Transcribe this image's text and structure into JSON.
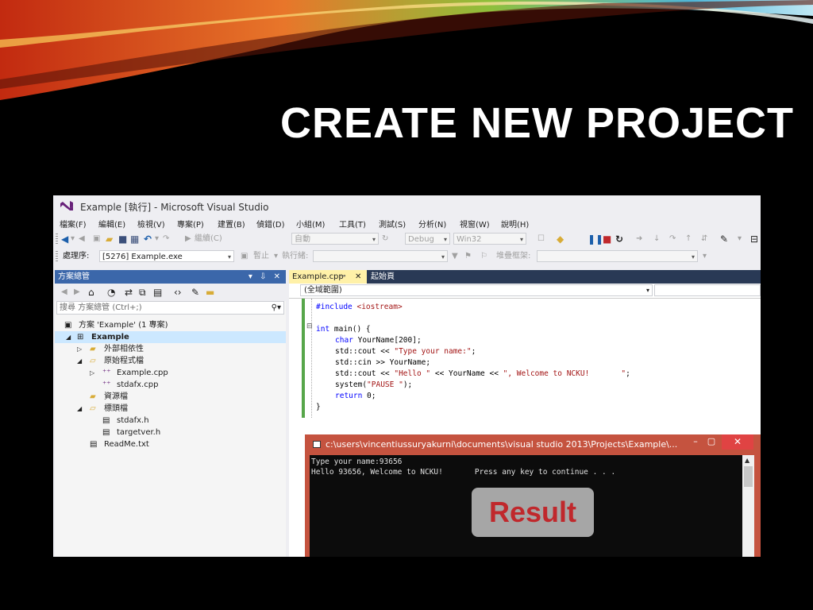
{
  "slide": {
    "title": "CREATE NEW PROJECT",
    "result_label": "Result"
  },
  "window": {
    "title": "Example [執行] - Microsoft Visual Studio"
  },
  "menu": [
    "檔案(F)",
    "編輯(E)",
    "檢視(V)",
    "專案(P)",
    "建置(B)",
    "偵錯(D)",
    "小組(M)",
    "工具(T)",
    "測試(S)",
    "分析(N)",
    "視窗(W)",
    "說明(H)"
  ],
  "toolbar1": {
    "continue_label": "繼續(C)",
    "auto_combo": "自動",
    "config_combo": "Debug",
    "platform_combo": "Win32"
  },
  "toolbar2": {
    "process_label": "處理序:",
    "process_value": "[5276] Example.exe",
    "suspend_label": "暫止",
    "thread_label": "執行緒:",
    "stackframe_label": "堆疊框架:"
  },
  "solution_explorer": {
    "header": "方案總管",
    "header_controls": "▾ ⇩ ✕",
    "search_placeholder": "搜尋 方案總管 (Ctrl+;)",
    "tree": [
      {
        "label": "方案 'Example' (1 專案)"
      },
      {
        "label": "Example"
      },
      {
        "label": "外部相依性"
      },
      {
        "label": "原始程式檔"
      },
      {
        "label": "Example.cpp"
      },
      {
        "label": "stdafx.cpp"
      },
      {
        "label": "資源檔"
      },
      {
        "label": "標頭檔"
      },
      {
        "label": "stdafx.h"
      },
      {
        "label": "targetver.h"
      },
      {
        "label": "ReadMe.txt"
      }
    ]
  },
  "editor": {
    "active_tab": "Example.cpp",
    "second_tab": "起始頁",
    "scope": "(全域範圍)",
    "code": {
      "l1a": "#include ",
      "l1b": "<iostream>",
      "l2a": "int",
      "l2b": " main() {",
      "l3a": "char",
      "l3b": " YourName[200];",
      "l4a": "std::cout << ",
      "l4b": "\"Type your name:\"",
      "l4c": ";",
      "l5": "std::cin >> YourName;",
      "l6a": "std::cout << ",
      "l6b": "\"Hello \"",
      "l6c": " << YourName << ",
      "l6d": "\", Welcome to NCKU!       \"",
      "l6e": ";",
      "l7a": "system(",
      "l7b": "\"PAUSE \"",
      "l7c": ");",
      "l8a": "return",
      "l8b": " 0;",
      "l9": "}"
    }
  },
  "console": {
    "title": "c:\\users\\vincentiussuryakurni\\documents\\visual studio 2013\\Projects\\Example\\...",
    "minimize": "–",
    "maximize": "▢",
    "close": "✕",
    "lines": [
      "Type your name:93656",
      "Hello 93656, Welcome to NCKU!       Press any key to continue . . ."
    ]
  },
  "colors": {
    "accent": "#3b67aa",
    "console_frame": "#c5533f",
    "result_text": "#c0282c"
  }
}
